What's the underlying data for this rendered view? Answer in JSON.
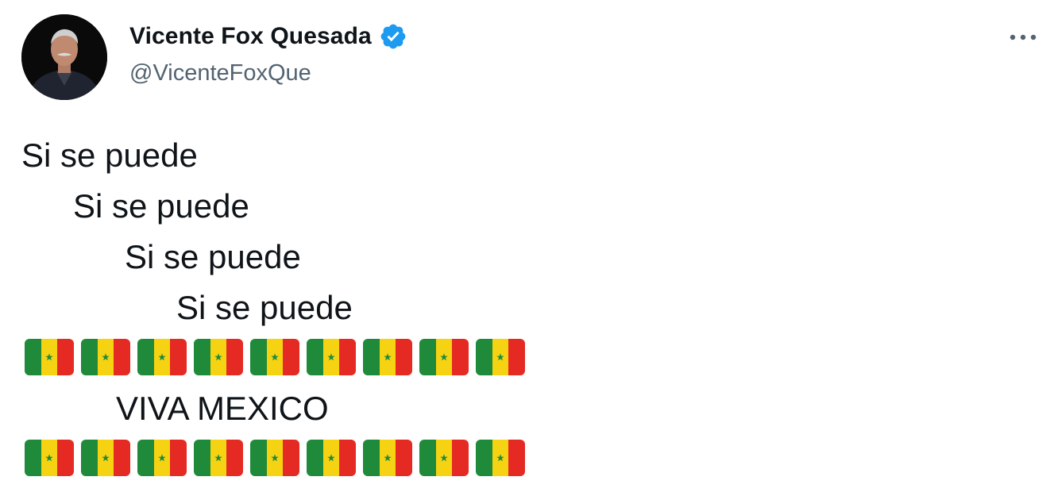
{
  "author": {
    "display_name": "Vicente Fox Quesada",
    "handle": "@VicenteFoxQue",
    "verified": true,
    "verified_color": "#1d9bf0"
  },
  "menu": {
    "icon": "more-horizontal-icon"
  },
  "tweet": {
    "lines": [
      "Si se puede",
      "Si se puede",
      "Si se puede",
      "Si se puede"
    ],
    "flag_emoji": "flag-senegal",
    "flags_per_row": 9,
    "viva_text": "VIVA MEXICO"
  },
  "colors": {
    "text": "#0f1419",
    "secondary_text": "#536471",
    "flag_green": "#1e8a3a",
    "flag_yellow": "#f6d312",
    "flag_red": "#e42a22"
  }
}
